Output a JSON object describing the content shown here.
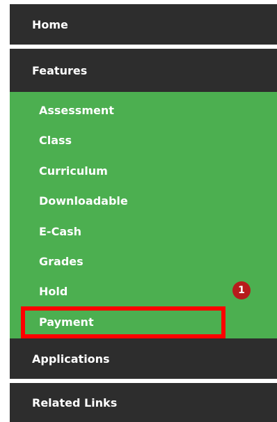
{
  "nav": {
    "home": "Home",
    "features": "Features",
    "applications": "Applications",
    "related_links": "Related Links"
  },
  "features_menu": {
    "items": [
      {
        "label": "Assessment"
      },
      {
        "label": "Class"
      },
      {
        "label": "Curriculum"
      },
      {
        "label": "Downloadable"
      },
      {
        "label": "E-Cash"
      },
      {
        "label": "Grades"
      },
      {
        "label": "Hold",
        "badge": "1"
      },
      {
        "label": "Payment",
        "highlighted": true
      }
    ]
  },
  "colors": {
    "header_bg": "#2d2d2d",
    "submenu_bg": "#4caf50",
    "badge_bg": "#b71c1c",
    "highlight_border": "#ff0000"
  }
}
